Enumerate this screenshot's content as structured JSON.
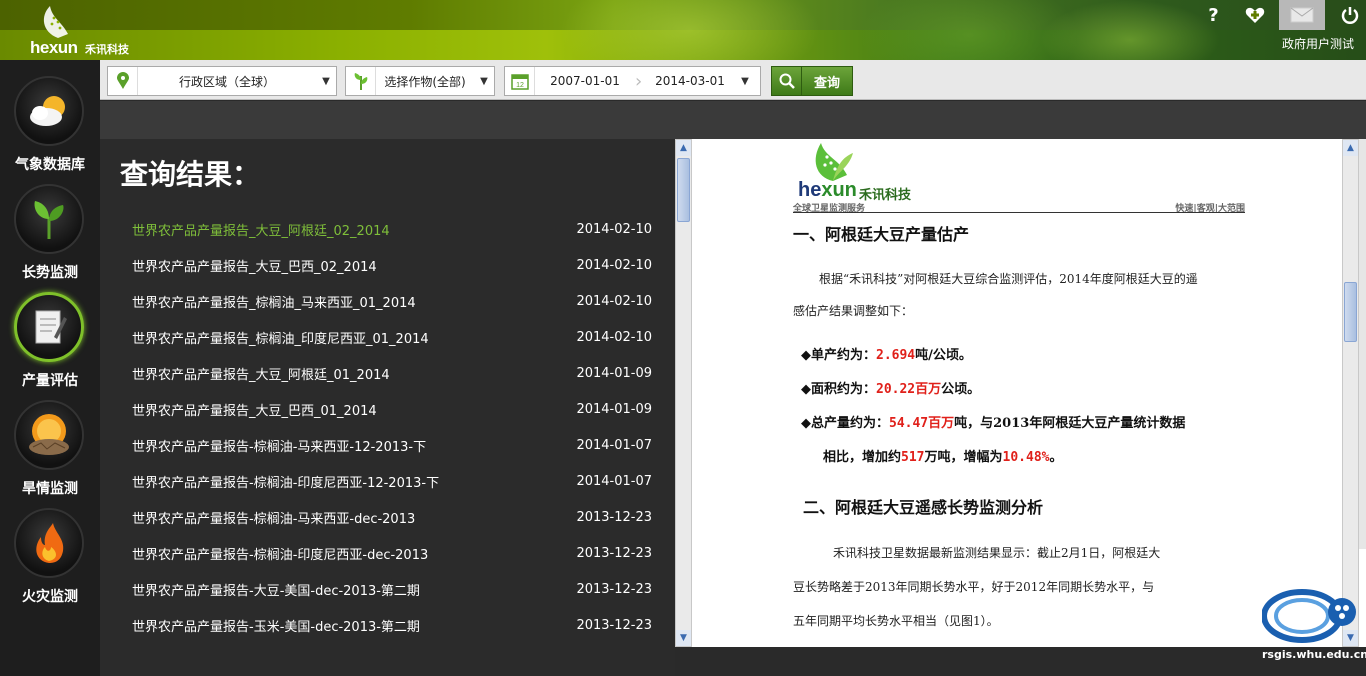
{
  "header": {
    "logo_text": "hexun",
    "logo_cn": "禾讯科技",
    "help_icon": "question-icon",
    "user_label": "政府用户测试"
  },
  "sidebar": {
    "items": [
      {
        "label": "气象数据库",
        "icon": "weather-icon"
      },
      {
        "label": "长势监测",
        "icon": "sprout-icon"
      },
      {
        "label": "产量评估",
        "icon": "document-edit-icon"
      },
      {
        "label": "旱情监测",
        "icon": "drought-icon"
      },
      {
        "label": "火灾监测",
        "icon": "fire-icon"
      }
    ],
    "active_index": 2
  },
  "toolbar": {
    "region": "行政区域（全球）",
    "crop": "选择作物(全部)",
    "date_start": "2007-01-01",
    "date_end": "2014-03-01",
    "query_label": "查询",
    "calendar_day": "12"
  },
  "results": {
    "title": "查询结果：",
    "rows": [
      {
        "title": "世界农产品产量报告_大豆_阿根廷_02_2014",
        "date": "2014-02-10"
      },
      {
        "title": "世界农产品产量报告_大豆_巴西_02_2014",
        "date": "2014-02-10"
      },
      {
        "title": "世界农产品产量报告_棕榈油_马来西亚_01_2014",
        "date": "2014-02-10"
      },
      {
        "title": "世界农产品产量报告_棕榈油_印度尼西亚_01_2014",
        "date": "2014-02-10"
      },
      {
        "title": "世界农产品产量报告_大豆_阿根廷_01_2014",
        "date": "2014-01-09"
      },
      {
        "title": "世界农产品产量报告_大豆_巴西_01_2014",
        "date": "2014-01-09"
      },
      {
        "title": "世界农产品产量报告-棕榈油-马来西亚-12-2013-下",
        "date": "2014-01-07"
      },
      {
        "title": "世界农产品产量报告-棕榈油-印度尼西亚-12-2013-下",
        "date": "2014-01-07"
      },
      {
        "title": "世界农产品产量报告-棕榈油-马来西亚-dec-2013",
        "date": "2013-12-23"
      },
      {
        "title": "世界农产品产量报告-棕榈油-印度尼西亚-dec-2013",
        "date": "2013-12-23"
      },
      {
        "title": "世界农产品产量报告-大豆-美国-dec-2013-第二期",
        "date": "2013-12-23"
      },
      {
        "title": "世界农产品产量报告-玉米-美国-dec-2013-第二期",
        "date": "2013-12-23"
      }
    ],
    "active_index": 0
  },
  "document": {
    "logo_text_a": "he",
    "logo_text_b": "xun",
    "logo_cn": "禾讯科技",
    "subtitle": "全球卫星监测服务",
    "tags": "快速|客观|大范围",
    "heading1": "一、阿根廷大豆产量估产",
    "para1_line1": "根据“禾讯科技”对阿根廷大豆综合监测评估，2014年度阿根廷大豆的遥",
    "para1_line2": "感估产结果调整如下：",
    "bullet1_label": "◆单产约为：",
    "bullet1_value": "2.694",
    "bullet1_unit": "吨/公顷。",
    "bullet2_label": "◆面积约为：",
    "bullet2_value": "20.22百万",
    "bullet2_unit": "公顷。",
    "bullet3_label": "◆总产量约为：",
    "bullet3_value": "54.47百万",
    "bullet3_unit": "吨，与2013年阿根廷大豆产量统计数据",
    "bullet3_line2_a": "相比，增加约",
    "bullet3_line2_v1": "517",
    "bullet3_line2_b": "万吨，增幅为",
    "bullet3_line2_v2": "10.48%",
    "bullet3_line2_c": "。",
    "heading2": "二、阿根廷大豆遥感长势监测分析",
    "para2_line1": "禾讯科技卫星数据最新监测结果显示：截止2月1日，阿根廷大",
    "para2_line2": "豆长势略差于2013年同期长势水平，好于2012年同期长势水平，与",
    "para2_line3": "五年同期平均长势水平相当（见图1）。"
  },
  "watermark": {
    "text": "rsgis.whu.edu.cn"
  }
}
